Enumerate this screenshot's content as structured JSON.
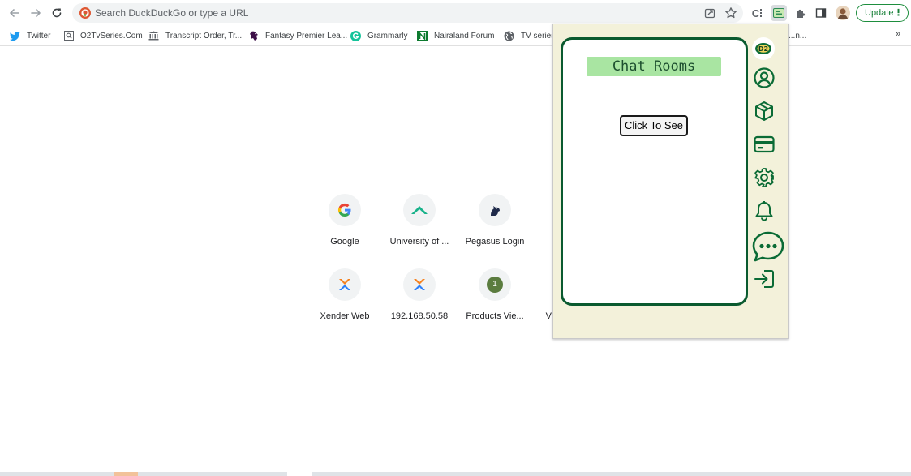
{
  "omnibox": {
    "placeholder": "Search DuckDuckGo or type a URL"
  },
  "toolbar": {
    "update_label": "Update",
    "update_menu": "⋮",
    "ext_short": "C"
  },
  "bookmarks": [
    {
      "label": "Twitter",
      "icon": "twitter-icon"
    },
    {
      "label": "O2TvSeries.Com",
      "icon": "search-box-icon"
    },
    {
      "label": "Transcript Order, Tr...",
      "icon": "institution-icon"
    },
    {
      "label": "Fantasy Premier Lea...",
      "icon": "premier-league-icon"
    },
    {
      "label": "Grammarly",
      "icon": "grammarly-icon"
    },
    {
      "label": "Nairaland Forum",
      "icon": "nairaland-icon"
    },
    {
      "label": "TV series",
      "icon": "globe-icon"
    },
    {
      "label": "...n...",
      "icon": ""
    }
  ],
  "bookmarks_more": "»",
  "shortcuts": [
    {
      "label": "Google",
      "icon": "google-icon"
    },
    {
      "label": "University of ...",
      "icon": "university-icon"
    },
    {
      "label": "Pegasus Login",
      "icon": "pegasus-icon"
    },
    {
      "label": "Xender Web",
      "icon": "xender-icon"
    },
    {
      "label": "192.168.50.58",
      "icon": "xender-icon"
    },
    {
      "label": "Products Vie...",
      "icon": "number-badge-icon",
      "badge": "1"
    },
    {
      "label": "V",
      "icon": ""
    }
  ],
  "popup": {
    "title": "Chat Rooms",
    "button_label": "Click To See",
    "logo_text": "D2",
    "sidebar_icons": [
      "profile-icon",
      "package-icon",
      "card-icon",
      "settings-icon",
      "bell-icon",
      "chat-icon",
      "logout-icon"
    ]
  },
  "colors": {
    "popup_bg": "#f3f1da",
    "frame_border": "#0a5a2f",
    "title_bg": "#a9e5a2",
    "icon_green": "#0a6b35",
    "update_green": "#1e8e3e"
  }
}
